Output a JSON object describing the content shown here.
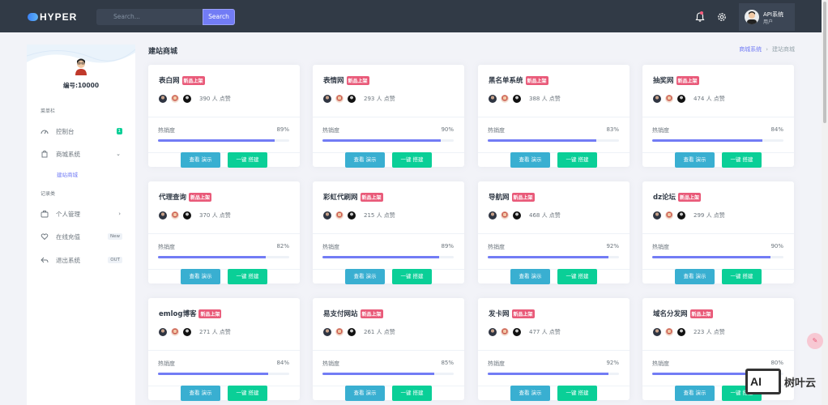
{
  "header": {
    "logo": "HYPER",
    "search_placeholder": "Search...",
    "search_button": "Search",
    "user_name": "API系统",
    "user_role": "用户"
  },
  "sidebar": {
    "user_id": "编号:10000",
    "section_menu": "菜单栏",
    "section_records": "记录类",
    "items": [
      {
        "label": "控制台",
        "badge": "1",
        "icon": "speedometer-icon"
      },
      {
        "label": "商城系统",
        "icon": "shopping-bag-icon"
      },
      {
        "label": "建站商城"
      },
      {
        "label": "个人管理",
        "icon": "briefcase-icon"
      },
      {
        "label": "在线充值",
        "badge": "New",
        "icon": "heart-icon"
      },
      {
        "label": "退出系统",
        "badge": "OUT",
        "icon": "reply-icon"
      }
    ]
  },
  "page": {
    "title": "建站商城",
    "breadcrumb": [
      "商城系统",
      "建站商城"
    ],
    "breadcrumb_sep": "›"
  },
  "cards": {
    "new_badge": "新品上架",
    "hot_label": "热销度",
    "demo_button": "查看 演示",
    "build_button": "一键 搭建",
    "items": [
      {
        "name": "表白网",
        "likes": "390 人 点赞",
        "hot": "89%",
        "hot_value": 89
      },
      {
        "name": "表情网",
        "likes": "293 人 点赞",
        "hot": "90%",
        "hot_value": 90
      },
      {
        "name": "黑名单系统",
        "likes": "388 人 点赞",
        "hot": "83%",
        "hot_value": 83
      },
      {
        "name": "抽奖网",
        "likes": "474 人 点赞",
        "hot": "84%",
        "hot_value": 84
      },
      {
        "name": "代理查询",
        "likes": "370 人 点赞",
        "hot": "82%",
        "hot_value": 82
      },
      {
        "name": "彩虹代刷网",
        "likes": "215 人 点赞",
        "hot": "89%",
        "hot_value": 89
      },
      {
        "name": "导航网",
        "likes": "468 人 点赞",
        "hot": "92%",
        "hot_value": 92
      },
      {
        "name": "dz论坛",
        "likes": "299 人 点赞",
        "hot": "90%",
        "hot_value": 90
      },
      {
        "name": "emlog博客",
        "likes": "271 人 点赞",
        "hot": "84%",
        "hot_value": 84
      },
      {
        "name": "易支付网站",
        "likes": "261 人 点赞",
        "hot": "85%",
        "hot_value": 85
      },
      {
        "name": "发卡网",
        "likes": "477 人 点赞",
        "hot": "92%",
        "hot_value": 92
      },
      {
        "name": "域名分发网",
        "likes": "223 人 点赞",
        "hot": "80%",
        "hot_value": 80
      }
    ]
  },
  "watermark": {
    "logo": "AI",
    "text": "树叶云"
  },
  "colors": {
    "primary": "#727cf5",
    "info": "#39afd1",
    "success": "#0acf97",
    "danger": "#e95a79",
    "topbar": "#313a46"
  }
}
